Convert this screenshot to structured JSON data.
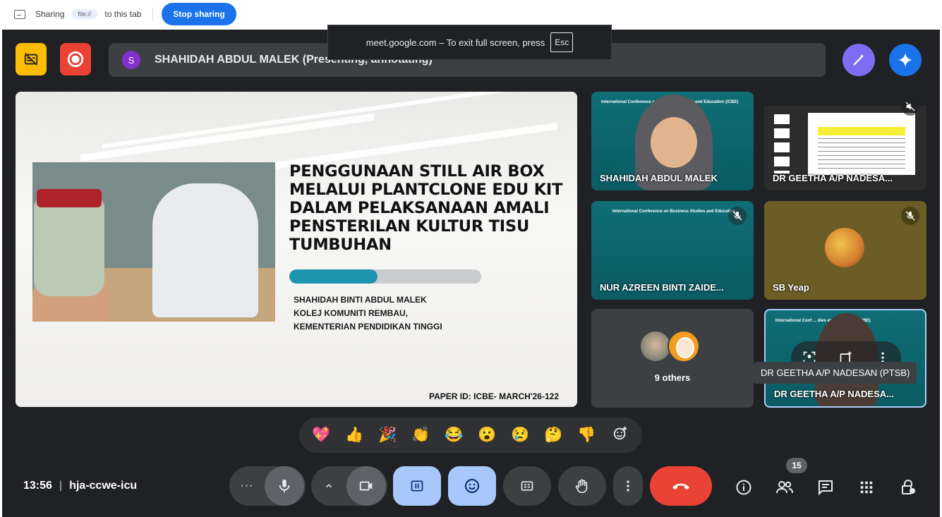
{
  "sharing_bar": {
    "label_sharing": "Sharing",
    "url": "file://",
    "label_tab": "to this tab",
    "stop_label": "Stop sharing"
  },
  "fullscreen_toast": {
    "text": "meet.google.com – To exit full screen, press",
    "key": "Esc"
  },
  "presenter": {
    "avatar_letter": "S",
    "name": "SHAHIDAH ABDUL MALEK (Presenting, annotating)"
  },
  "slide": {
    "title": "PENGGUNAAN STILL AIR BOX MELALUI PLANTCLONE EDU KIT DALAM PELAKSANAAN AMALI PENSTERILAN KULTUR TISU TUMBUHAN",
    "progress_fraction": 0.46,
    "author_lines": [
      "SHAHIDAH BINTI ABDUL MALEK",
      "KOLEJ KOMUNITI REMBAU,",
      "KEMENTERIAN PENDIDIKAN TINGGI"
    ],
    "paper_id": "PAPER ID: ICBE- MARCH'26-122"
  },
  "tiles": {
    "shahidah": {
      "name": "SHAHIDAH ABDUL MALEK",
      "header": "International Conference on Business Studies and Education (ICBE)"
    },
    "geetha_screen": {
      "name": "DR GEETHA A/P NADESA..."
    },
    "nur": {
      "name": "NUR AZREEN BINTI ZAIDE...",
      "header": "International Conference on Business Studies and Education"
    },
    "sb": {
      "name": "SB Yeap"
    },
    "others": {
      "label": "9 others"
    },
    "geetha_cam": {
      "name": "DR GEETHA A/P NADESA...",
      "header": "International Conf  ...  dies and Education (ICBE)"
    }
  },
  "tooltip": "DR GEETHA A/P NADESAN (PTSB)",
  "reactions": [
    "💖",
    "👍",
    "🎉",
    "👏",
    "😂",
    "😮",
    "😢",
    "🤔",
    "👎",
    "add-reaction-icon"
  ],
  "bottom": {
    "time": "13:56",
    "separator": "|",
    "meeting_code": "hja-ccwe-icu",
    "participants_count": "15"
  },
  "colors": {
    "meet_bg": "#202124",
    "stop_sharing": "#1a73e8",
    "end_call": "#ea4335",
    "active_control": "#a8c7fa",
    "presenter_avatar": "#8430ce",
    "record": "#ea4335",
    "captions_off": "#fbbc04"
  }
}
